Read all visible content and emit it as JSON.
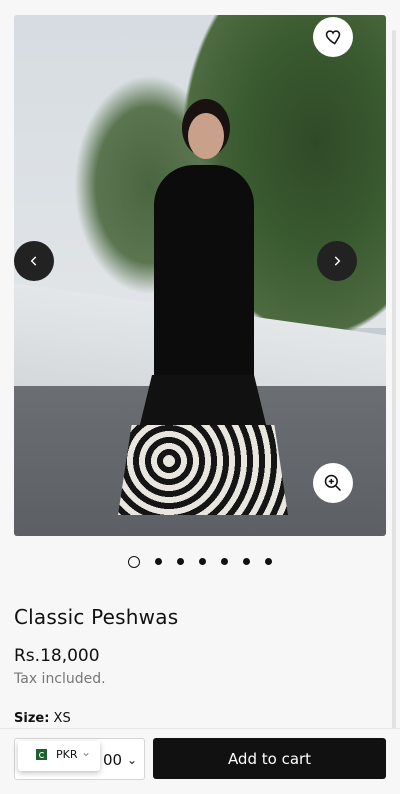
{
  "gallery": {
    "image_alt": "Classic Peshwas product photo",
    "favorite_icon": "heart-icon",
    "zoom_icon": "zoom-in-icon",
    "prev_icon": "chevron-left-icon",
    "next_icon": "chevron-right-icon",
    "slide_count": 7,
    "active_slide": 1
  },
  "product": {
    "title": "Classic Peshwas",
    "price": "Rs.18,000",
    "tax_note": "Tax included.",
    "size_label": "Size:",
    "size_value": "XS"
  },
  "cart": {
    "quantity_partial": "00",
    "quantity_chevron": "chevron-down-icon",
    "add_label": "Add to cart",
    "accent": "#111111"
  },
  "currency": {
    "code": "PKR",
    "flag_icon": "pakistan-flag-icon",
    "chevron": "chevron-down-icon"
  }
}
